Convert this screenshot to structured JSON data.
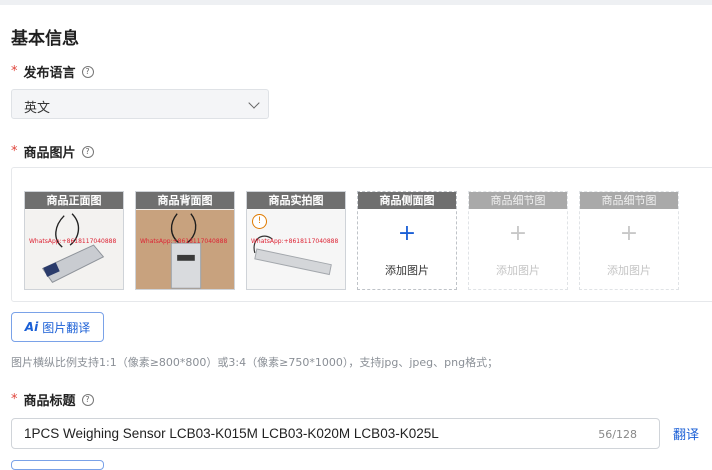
{
  "section": {
    "title": "基本信息"
  },
  "language": {
    "label": "发布语言",
    "required": "*",
    "help": "?",
    "selected": "英文"
  },
  "images": {
    "label": "商品图片",
    "required": "*",
    "help": "?",
    "add_text": "添加图片",
    "plus": "+",
    "slots": [
      {
        "title": "商品正面图",
        "state": "filled",
        "watermark": "WhatsApp:+8618117040888"
      },
      {
        "title": "商品背面图",
        "state": "filled",
        "watermark": "WhatsApp:+8618117040888"
      },
      {
        "title": "商品实拍图",
        "state": "filled",
        "watermark": "WhatsApp:+8618117040888"
      },
      {
        "title": "商品侧面图",
        "state": "empty"
      },
      {
        "title": "商品细节图",
        "state": "disabled"
      },
      {
        "title": "商品细节图",
        "state": "disabled"
      }
    ],
    "alert_icon": "!",
    "translate_button": {
      "icon": "Ai",
      "label": "图片翻译"
    },
    "hint": "图片横纵比例支持1:1（像素≥800*800）或3:4（像素≥750*1000），支持jpg、jpeg、png格式；"
  },
  "product_title": {
    "label": "商品标题",
    "required": "*",
    "help": "?",
    "value": "1PCS Weighing Sensor LCB03-K015M LCB03-K020M LCB03-K025L",
    "count": "56/128",
    "translate_link": "翻译"
  },
  "colors": {
    "accent": "#1a5fd6",
    "required": "#e0443b",
    "slot_bar": "#6f6f6f"
  }
}
